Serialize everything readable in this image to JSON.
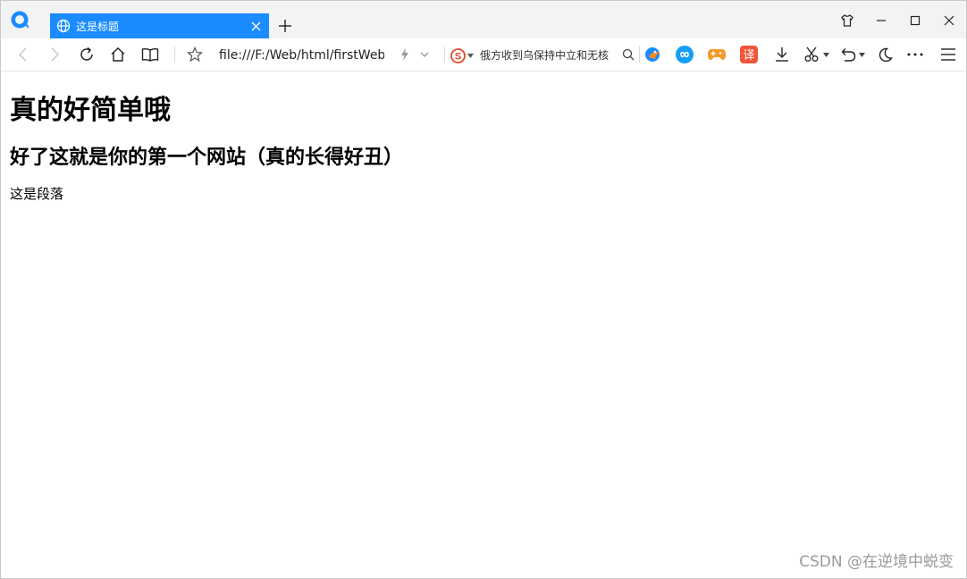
{
  "browser": {
    "tab": {
      "title": "这是标题"
    },
    "address": "file:///F:/Web/html/firstWeb",
    "search_text": "俄方收到乌保持中立和无核"
  },
  "icons": {
    "app_logo": "browser-logo-icon",
    "tab_globe": "globe-icon",
    "tab_close": "close-icon",
    "new_tab": "plus-icon",
    "skin": "shirt-icon",
    "minimize": "minimize-icon",
    "maximize": "maximize-icon",
    "close_window": "close-window-icon",
    "back": "back-icon",
    "forward": "forward-icon",
    "reload": "reload-icon",
    "home": "home-icon",
    "reader": "book-icon",
    "favorite": "star-icon",
    "fast_mode": "lightning-icon",
    "dropdown": "chevron-down-icon",
    "search_engine": "sogou-icon",
    "search_magnifier": "search-icon"
  },
  "page": {
    "h1": "真的好简单哦",
    "h2": "好了这就是你的第一个网站（真的长得好丑）",
    "p": "这是段落"
  },
  "watermark": "CSDN @在逆境中蜕变",
  "colors": {
    "tab_active": "#1a8cff",
    "titlebar_bg": "#f2f3f5",
    "logo_blue": "#1a8cff",
    "translate_red": "#f0553a",
    "game_orange": "#f39b2d",
    "infinity_blue": "#14a0f5"
  }
}
